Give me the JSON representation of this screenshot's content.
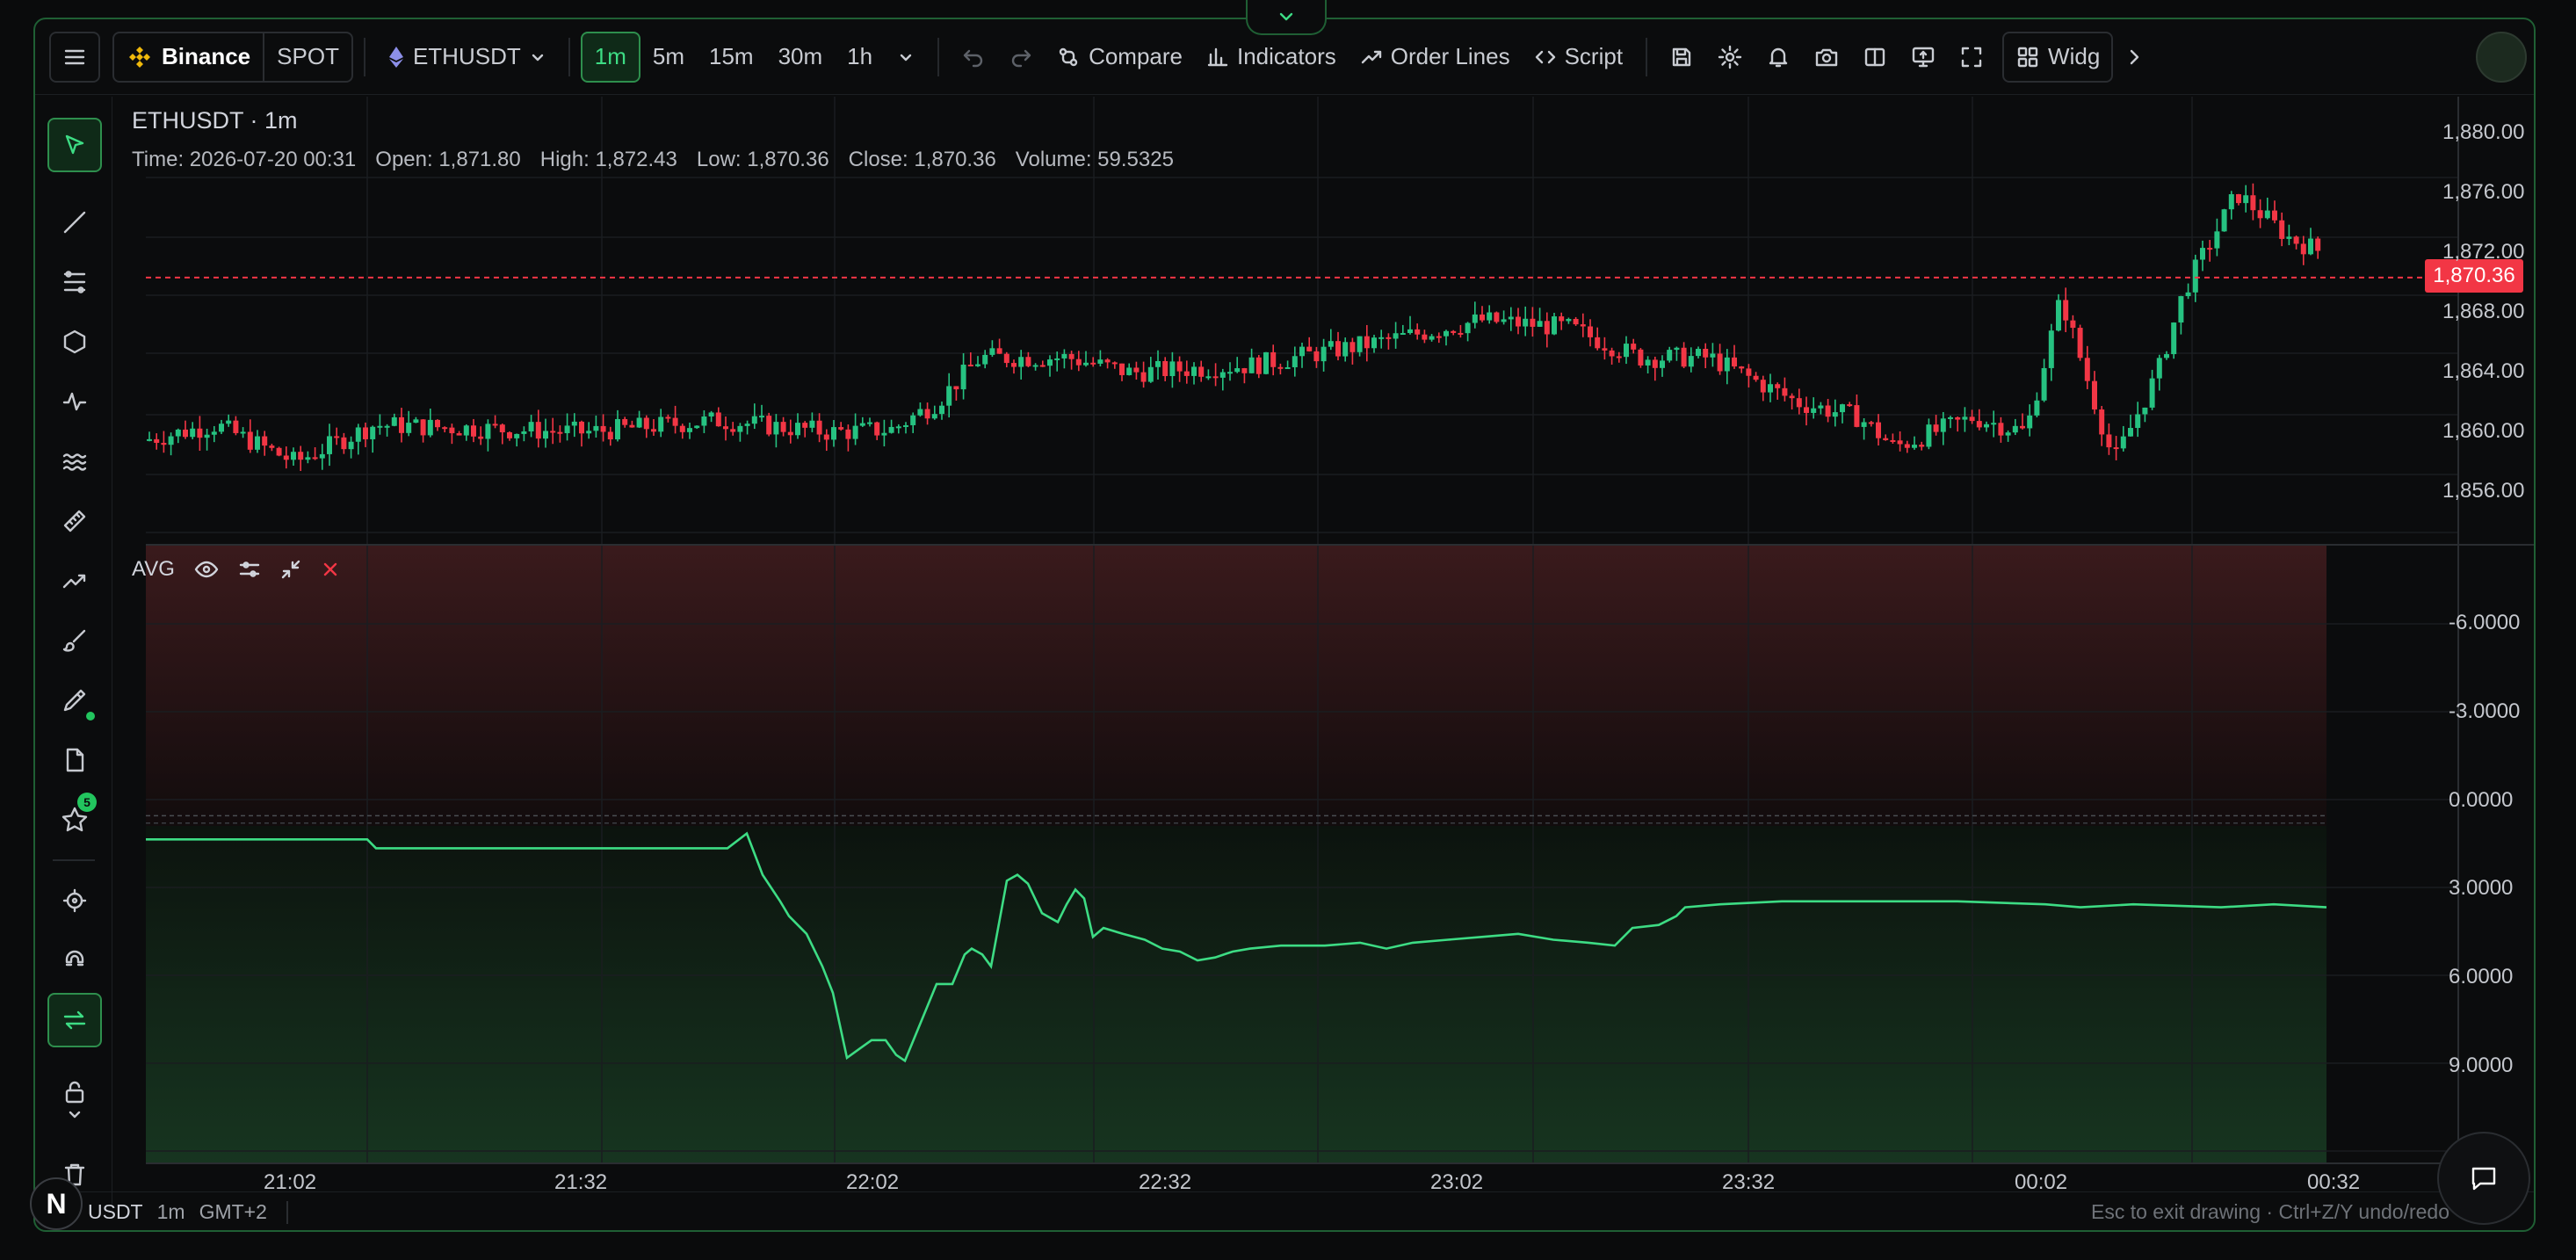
{
  "toolbar": {
    "exchange": "Binance",
    "market": "SPOT",
    "symbol": "ETHUSDT",
    "intervals": [
      "1m",
      "5m",
      "15m",
      "30m",
      "1h"
    ],
    "active_interval": "1m",
    "compare": "Compare",
    "indicators": "Indicators",
    "order_lines": "Order Lines",
    "script": "Script",
    "widgets": "Widg"
  },
  "legend": {
    "title": "ETHUSDT · 1m",
    "time_label": "Time: 2026-07-20 00:31",
    "open_label": "Open: 1,871.80",
    "high_label": "High: 1,872.43",
    "low_label": "Low: 1,870.36",
    "close_label": "Close: 1,870.36",
    "volume_label": "Volume: 59.5325"
  },
  "indicator": {
    "name": "AVG"
  },
  "price_axis": [
    "1,880.00",
    "1,876.00",
    "1,872.00",
    "1,868.00",
    "1,864.00",
    "1,860.00",
    "1,856.00"
  ],
  "last_price": "1,870.36",
  "avg_axis": [
    "-6.0000",
    "-3.0000",
    "0.0000",
    "3.0000",
    "6.0000",
    "9.0000"
  ],
  "time_axis": [
    "21:02",
    "21:32",
    "22:02",
    "22:32",
    "23:02",
    "23:32",
    "00:02",
    "00:32"
  ],
  "status": {
    "symbol": "USDT",
    "interval": "1m",
    "timezone": "GMT+2",
    "hint": "Esc to exit drawing · Ctrl+Z/Y undo/redo"
  },
  "left_tools": {
    "favorites_count": "5",
    "brand_letter": "N"
  },
  "colors": {
    "up": "#26c281",
    "down": "#f23645",
    "accent": "#3ddc84",
    "avg_line": "#3ddc84"
  }
}
